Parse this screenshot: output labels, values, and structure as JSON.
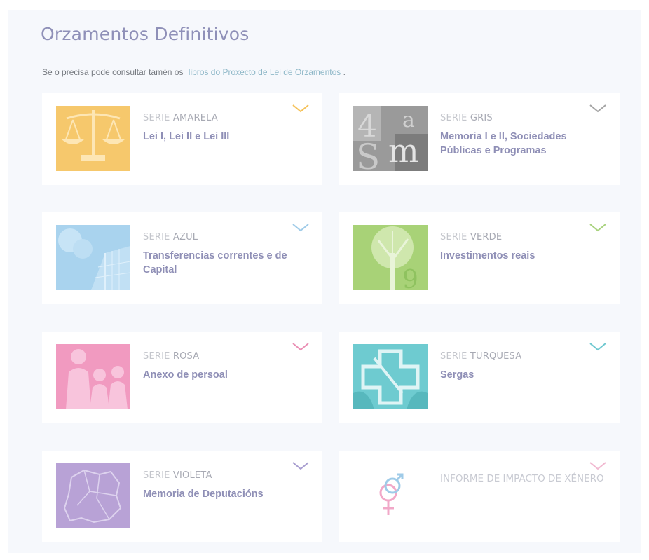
{
  "page": {
    "title": "Orzamentos Definitivos",
    "intro_text": "Se o precisa pode consultar tamén os",
    "intro_link": "libros do Proxecto de Lei de Orzamentos",
    "intro_end": "."
  },
  "series_prefix": "SERIE",
  "cards": [
    {
      "series": "AMARELA",
      "title": "Lei I, Lei II e Lei III",
      "color": "#f6c86c"
    },
    {
      "series": "GRIS",
      "title": "Memoria I e II, Sociedades Públicas e Programas",
      "color": "#9a9a9a"
    },
    {
      "series": "AZUL",
      "title": "Transferencias correntes e de Capital",
      "color": "#a9d3ee"
    },
    {
      "series": "VERDE",
      "title": "Investimentos reais",
      "color": "#a8d277"
    },
    {
      "series": "ROSA",
      "title": "Anexo de persoal",
      "color": "#f19ac0"
    },
    {
      "series": "TURQUESA",
      "title": "Sergas",
      "color": "#6ecbd0"
    },
    {
      "series": "VIOLETA",
      "title": "Memoria de Deputacións",
      "color": "#b8a2d6"
    },
    {
      "title": "INFORME DE IMPACTO DE XÉNERO",
      "color": "#f4c4d8"
    }
  ],
  "chevron_colors": [
    "#f5c25a",
    "#a4a4a4",
    "#9fcbe8",
    "#a8d27d",
    "#ea8fb4",
    "#6fc8d0",
    "#a89ed0",
    "#f1b8d0"
  ],
  "icons": [
    "scales-icon",
    "letters-icon",
    "building-icon",
    "tree-icon",
    "people-icon",
    "cross-icon",
    "map-icon",
    "gender-icon"
  ]
}
